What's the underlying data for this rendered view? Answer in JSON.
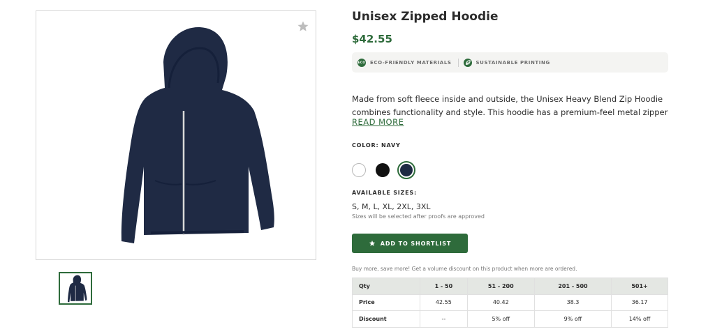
{
  "product": {
    "title": "Unisex Zipped Hoodie",
    "price": "$42.55",
    "badges": [
      {
        "icon": "eco-icon",
        "icon_text": "ECO",
        "label": "ECO-FRIENDLY MATERIALS"
      },
      {
        "icon": "leaf-icon",
        "label": "SUSTAINABLE PRINTING"
      }
    ],
    "description_lines": [
      "Made from soft fleece inside and outside, the Unisex Heavy Blend Zip Hoodie",
      "combines functionality and style. This hoodie has a premium-feel metal zipper and..."
    ],
    "read_more": "READ MORE",
    "color_label": "COLOR: NAVY",
    "colors": [
      {
        "name": "white",
        "hex": "#ffffff"
      },
      {
        "name": "black",
        "hex": "#111111"
      },
      {
        "name": "navy",
        "hex": "#1f2a44",
        "selected": true
      }
    ],
    "sizes_label": "AVAILABLE SIZES:",
    "sizes": "S, M, L, XL, 2XL, 3XL",
    "sizes_note": "Sizes will be selected after proofs are approved",
    "shortlist_button": "ADD TO SHORTLIST",
    "volume_note": "Buy more, save more! Get a volume discount on this product when more are ordered."
  },
  "pricing_table": {
    "headers": [
      "Qty",
      "1 - 50",
      "51 - 200",
      "201 - 500",
      "501+"
    ],
    "rows": [
      [
        "Price",
        "42.55",
        "40.42",
        "38.3",
        "36.17"
      ],
      [
        "Discount",
        "--",
        "5% off",
        "9% off",
        "14% off"
      ]
    ]
  },
  "theme": {
    "accent": "#2e6b3b",
    "hoodie_color": "#1f2a44"
  }
}
